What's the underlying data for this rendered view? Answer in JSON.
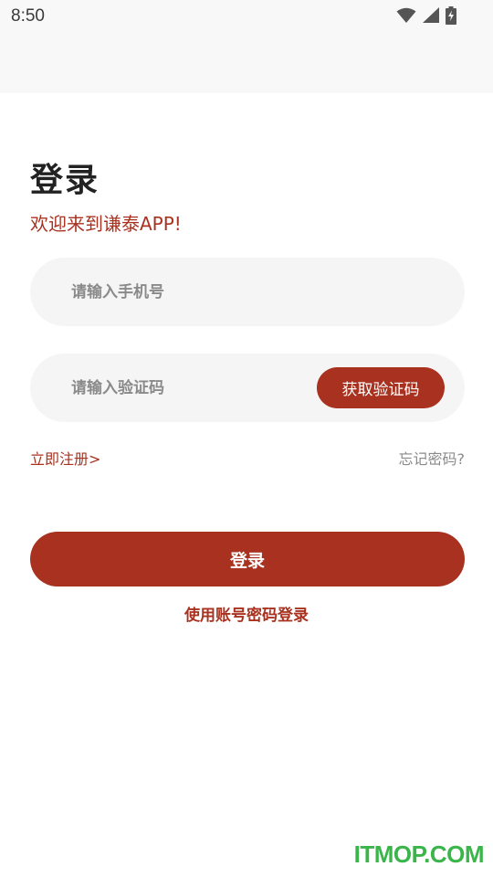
{
  "status_bar": {
    "time": "8:50",
    "icons": [
      "wifi-icon",
      "signal-icon",
      "battery-charging-icon"
    ]
  },
  "login": {
    "title": "登录",
    "subtitle": "欢迎来到谦泰APP!",
    "phone_placeholder": "请输入手机号",
    "code_placeholder": "请输入验证码",
    "get_code_label": "获取验证码",
    "register_label": "立即注册>",
    "forgot_label": "忘记密码?",
    "submit_label": "登录",
    "password_login_label": "使用账号密码登录"
  },
  "watermark": "ITMOP.COM",
  "colors": {
    "accent": "#a8321f",
    "input_bg": "#f5f5f5",
    "status_bg": "#f8f8f8",
    "watermark": "#39b54a"
  }
}
